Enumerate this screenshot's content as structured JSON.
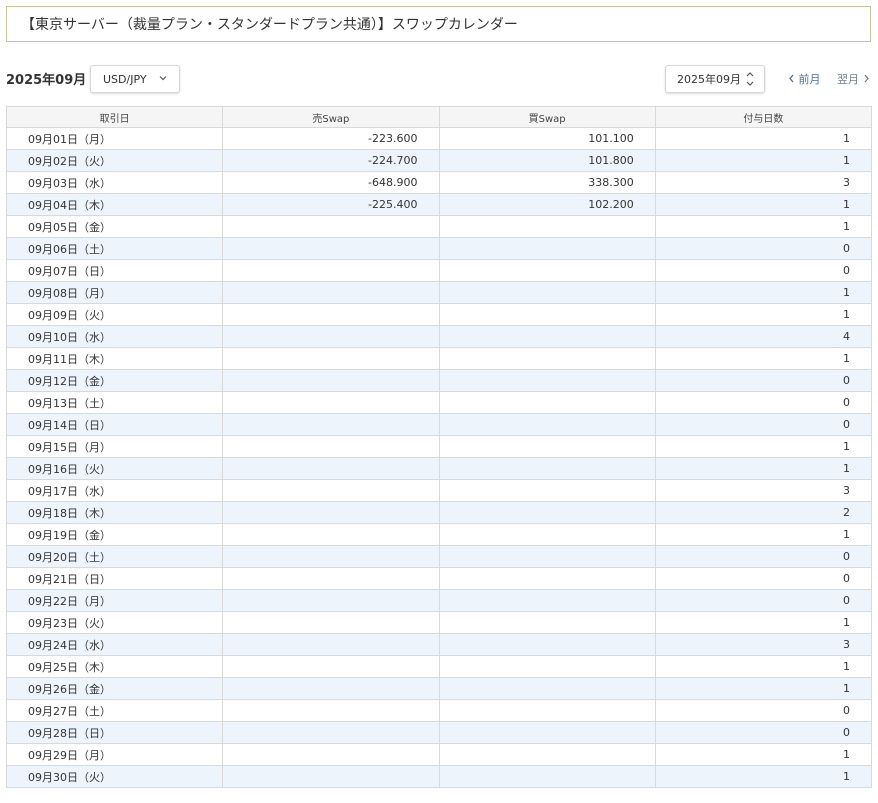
{
  "header": {
    "title": "【東京サーバー（裁量プラン・スタンダードプラン共通）】スワップカレンダー"
  },
  "toolbar": {
    "month_label": "2025年09月",
    "pair_value": "USD/JPY",
    "date_value": "2025年09月",
    "prev_label": "前月",
    "next_label": "翌月"
  },
  "table": {
    "columns": [
      "取引日",
      "売Swap",
      "買Swap",
      "付与日数"
    ],
    "rows": [
      {
        "date": "09月01日（月）",
        "sell": "-223.600",
        "buy": "101.100",
        "days": "1"
      },
      {
        "date": "09月02日（火）",
        "sell": "-224.700",
        "buy": "101.800",
        "days": "1"
      },
      {
        "date": "09月03日（水）",
        "sell": "-648.900",
        "buy": "338.300",
        "days": "3"
      },
      {
        "date": "09月04日（木）",
        "sell": "-225.400",
        "buy": "102.200",
        "days": "1"
      },
      {
        "date": "09月05日（金）",
        "sell": "",
        "buy": "",
        "days": "1"
      },
      {
        "date": "09月06日（土）",
        "sell": "",
        "buy": "",
        "days": "0"
      },
      {
        "date": "09月07日（日）",
        "sell": "",
        "buy": "",
        "days": "0"
      },
      {
        "date": "09月08日（月）",
        "sell": "",
        "buy": "",
        "days": "1"
      },
      {
        "date": "09月09日（火）",
        "sell": "",
        "buy": "",
        "days": "1"
      },
      {
        "date": "09月10日（水）",
        "sell": "",
        "buy": "",
        "days": "4"
      },
      {
        "date": "09月11日（木）",
        "sell": "",
        "buy": "",
        "days": "1"
      },
      {
        "date": "09月12日（金）",
        "sell": "",
        "buy": "",
        "days": "0"
      },
      {
        "date": "09月13日（土）",
        "sell": "",
        "buy": "",
        "days": "0"
      },
      {
        "date": "09月14日（日）",
        "sell": "",
        "buy": "",
        "days": "0"
      },
      {
        "date": "09月15日（月）",
        "sell": "",
        "buy": "",
        "days": "1"
      },
      {
        "date": "09月16日（火）",
        "sell": "",
        "buy": "",
        "days": "1"
      },
      {
        "date": "09月17日（水）",
        "sell": "",
        "buy": "",
        "days": "3"
      },
      {
        "date": "09月18日（木）",
        "sell": "",
        "buy": "",
        "days": "2"
      },
      {
        "date": "09月19日（金）",
        "sell": "",
        "buy": "",
        "days": "1"
      },
      {
        "date": "09月20日（土）",
        "sell": "",
        "buy": "",
        "days": "0"
      },
      {
        "date": "09月21日（日）",
        "sell": "",
        "buy": "",
        "days": "0"
      },
      {
        "date": "09月22日（月）",
        "sell": "",
        "buy": "",
        "days": "0"
      },
      {
        "date": "09月23日（火）",
        "sell": "",
        "buy": "",
        "days": "1"
      },
      {
        "date": "09月24日（水）",
        "sell": "",
        "buy": "",
        "days": "3"
      },
      {
        "date": "09月25日（木）",
        "sell": "",
        "buy": "",
        "days": "1"
      },
      {
        "date": "09月26日（金）",
        "sell": "",
        "buy": "",
        "days": "1"
      },
      {
        "date": "09月27日（土）",
        "sell": "",
        "buy": "",
        "days": "0"
      },
      {
        "date": "09月28日（日）",
        "sell": "",
        "buy": "",
        "days": "0"
      },
      {
        "date": "09月29日（月）",
        "sell": "",
        "buy": "",
        "days": "1"
      },
      {
        "date": "09月30日（火）",
        "sell": "",
        "buy": "",
        "days": "1"
      }
    ]
  },
  "icons": {
    "pair_dropdown": "chevron-down-icon",
    "date_stepper": "up-down-arrows-icon",
    "prev": "chevron-left-icon",
    "next": "chevron-right-icon"
  },
  "colors": {
    "title_border": "#c7c49a",
    "row_alt": "#eef4fb",
    "link": "#4a6fa5"
  }
}
